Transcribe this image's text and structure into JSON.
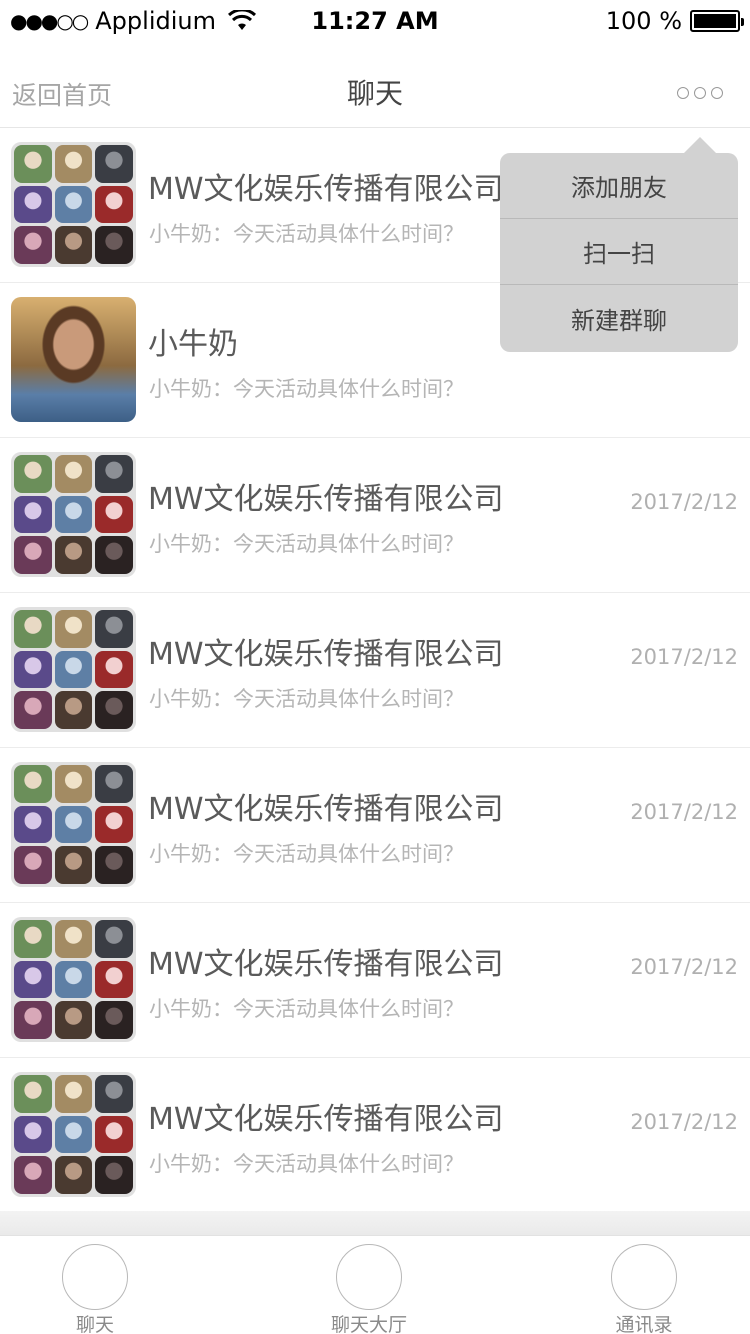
{
  "status_bar": {
    "carrier": "Applidium",
    "signal_dots": "●●●○○",
    "time": "11:27 AM",
    "battery_text": "100 %",
    "battery_level": 1.0
  },
  "nav": {
    "back_label": "返回首页",
    "title": "聊天",
    "more_icon": "more-dots-icon"
  },
  "popup_menu": {
    "items": [
      "添加朋友",
      "扫一扫",
      "新建群聊"
    ]
  },
  "conversations": [
    {
      "name": "MW文化娱乐传播有限公司",
      "message": "小牛奶：今天活动具体什么时间？",
      "date": "",
      "avatar": "group"
    },
    {
      "name": "小牛奶",
      "message": "小牛奶：今天活动具体什么时间？",
      "date": "",
      "avatar": "single"
    },
    {
      "name": "MW文化娱乐传播有限公司",
      "message": "小牛奶：今天活动具体什么时间？",
      "date": "2017/2/12",
      "avatar": "group"
    },
    {
      "name": "MW文化娱乐传播有限公司",
      "message": "小牛奶：今天活动具体什么时间？",
      "date": "2017/2/12",
      "avatar": "group"
    },
    {
      "name": "MW文化娱乐传播有限公司",
      "message": "小牛奶：今天活动具体什么时间？",
      "date": "2017/2/12",
      "avatar": "group"
    },
    {
      "name": "MW文化娱乐传播有限公司",
      "message": "小牛奶：今天活动具体什么时间？",
      "date": "2017/2/12",
      "avatar": "group"
    },
    {
      "name": "MW文化娱乐传播有限公司",
      "message": "小牛奶：今天活动具体什么时间？",
      "date": "2017/2/12",
      "avatar": "group"
    }
  ],
  "tabs": [
    {
      "label": "聊天",
      "icon": "chat-tab-icon"
    },
    {
      "label": "聊天大厅",
      "icon": "chat-hall-tab-icon"
    },
    {
      "label": "通讯录",
      "icon": "contacts-tab-icon"
    }
  ],
  "colors": {
    "popup_bg": "#d2d2d2",
    "secondary_text": "#b5b5b5",
    "name_text": "#5a5a5a"
  }
}
